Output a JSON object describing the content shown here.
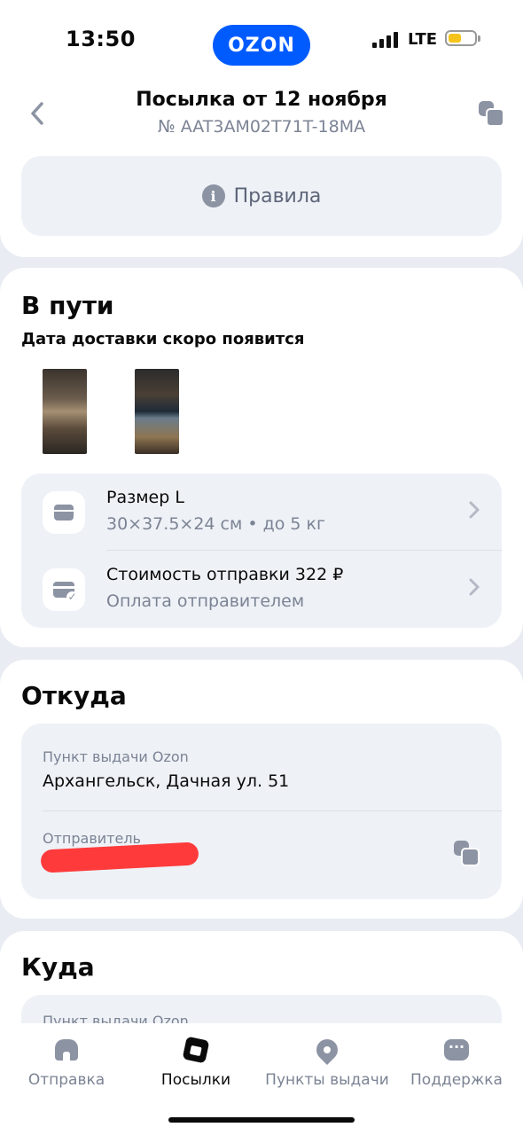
{
  "status_bar": {
    "time": "13:50",
    "brand": "OZON",
    "network": "LTE"
  },
  "header": {
    "title": "Посылка от 12 ноября",
    "tracking_number": "№ AAT3AM02T71T-18MA",
    "rules_label": "Правила"
  },
  "transit": {
    "status": "В пути",
    "delivery_note": "Дата доставки скоро появится",
    "size_title": "Размер L",
    "size_detail": "30×37.5×24 см • до 5 кг",
    "cost_title": "Стоимость отправки 322 ₽",
    "cost_detail": "Оплата отправителем"
  },
  "from": {
    "heading": "Откуда",
    "pickup_label": "Пункт выдачи Ozon",
    "pickup_address": "Архангельск, Дачная ул. 51",
    "sender_label": "Отправитель"
  },
  "to": {
    "heading": "Куда",
    "pickup_label": "Пункт выдачи Ozon"
  },
  "tabbar": {
    "items": [
      {
        "label": "Отправка",
        "icon": "home-icon"
      },
      {
        "label": "Посылки",
        "icon": "parcel-icon",
        "active": true
      },
      {
        "label": "Пункты выдачи",
        "icon": "pin-icon"
      },
      {
        "label": "Поддержка",
        "icon": "chat-icon"
      }
    ]
  },
  "colors": {
    "accent": "#005bff",
    "battery": "#f6c31b",
    "redaction": "#ff2a2a"
  }
}
